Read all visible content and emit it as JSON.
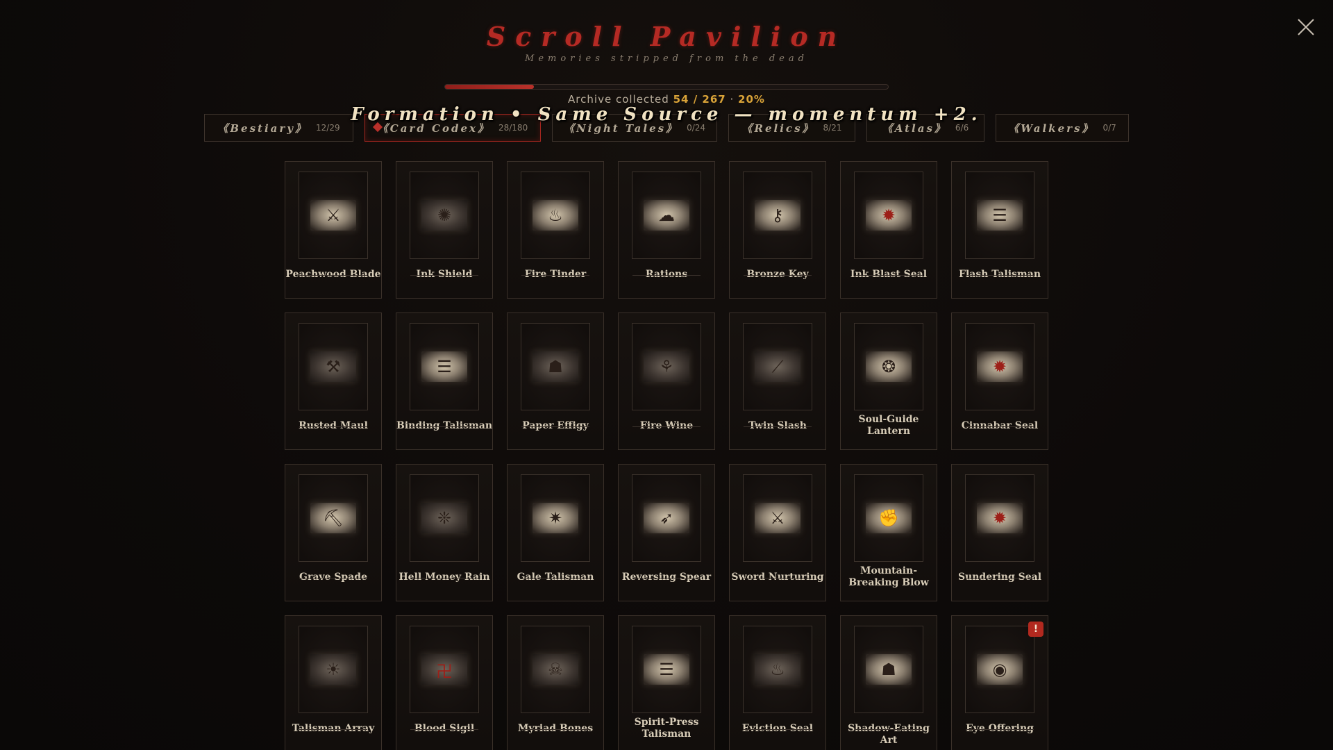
{
  "header": {
    "title": "Scroll Pavilion",
    "subtitle": "Memories stripped from the dead",
    "close_icon": "close-icon"
  },
  "progress": {
    "fraction": 0.2,
    "label": "Archive collected",
    "collected": "54",
    "total": "267",
    "percent": "20%",
    "separator_slash": " / ",
    "separator_dot": " · "
  },
  "banner": {
    "text": "Formation • Same Source — momentum +2."
  },
  "tabs": [
    {
      "name": "《Bestiary》",
      "count": "12/29",
      "active": false
    },
    {
      "name": "《Card Codex》",
      "count": "28/180",
      "active": true
    },
    {
      "name": "《Night Tales》",
      "count": "0/24",
      "active": false
    },
    {
      "name": "《Relics》",
      "count": "8/21",
      "active": false
    },
    {
      "name": "《Atlas》",
      "count": "6/6",
      "active": false
    },
    {
      "name": "《Walkers》",
      "count": "0/7",
      "active": false
    }
  ],
  "cards": [
    {
      "name": "Peachwood Blade",
      "icon": "sword-icon"
    },
    {
      "name": "Ink Shield",
      "icon": "shield-icon"
    },
    {
      "name": "Fire Tinder",
      "icon": "tinder-icon"
    },
    {
      "name": "Rations",
      "icon": "rations-icon"
    },
    {
      "name": "Bronze Key",
      "icon": "key-icon"
    },
    {
      "name": "Ink Blast Seal",
      "icon": "seal-icon"
    },
    {
      "name": "Flash Talisman",
      "icon": "talisman-icon"
    },
    {
      "name": "Rusted Maul",
      "icon": "maul-icon"
    },
    {
      "name": "Binding Talisman",
      "icon": "talisman-icon"
    },
    {
      "name": "Paper Effigy",
      "icon": "effigy-icon"
    },
    {
      "name": "Fire Wine",
      "icon": "wine-icon"
    },
    {
      "name": "Twin Slash",
      "icon": "slash-icon"
    },
    {
      "name": "Soul-Guide Lantern",
      "icon": "lantern-icon"
    },
    {
      "name": "Cinnabar Seal",
      "icon": "seal-icon"
    },
    {
      "name": "Grave Spade",
      "icon": "spade-icon"
    },
    {
      "name": "Hell Money Rain",
      "icon": "coins-icon"
    },
    {
      "name": "Gale Talisman",
      "icon": "wind-icon"
    },
    {
      "name": "Reversing Spear",
      "icon": "spear-icon"
    },
    {
      "name": "Sword Nurturing",
      "icon": "sword-icon"
    },
    {
      "name": "Mountain-Breaking Blow",
      "icon": "fist-icon"
    },
    {
      "name": "Sundering Seal",
      "icon": "seal-icon"
    },
    {
      "name": "Talisman Array",
      "icon": "array-icon"
    },
    {
      "name": "Blood Sigil",
      "icon": "sigil-icon"
    },
    {
      "name": "Myriad Bones",
      "icon": "bones-icon"
    },
    {
      "name": "Spirit-Press Talisman",
      "icon": "talisman-icon"
    },
    {
      "name": "Eviction Seal",
      "icon": "flame-icon"
    },
    {
      "name": "Shadow-Eating Art",
      "icon": "shadow-icon"
    },
    {
      "name": "Eye Offering",
      "icon": "eye-icon",
      "badge": "!"
    }
  ],
  "colors": {
    "accent_red": "#b52a24",
    "gold": "#d9a338",
    "background": "#0e0b0a"
  }
}
